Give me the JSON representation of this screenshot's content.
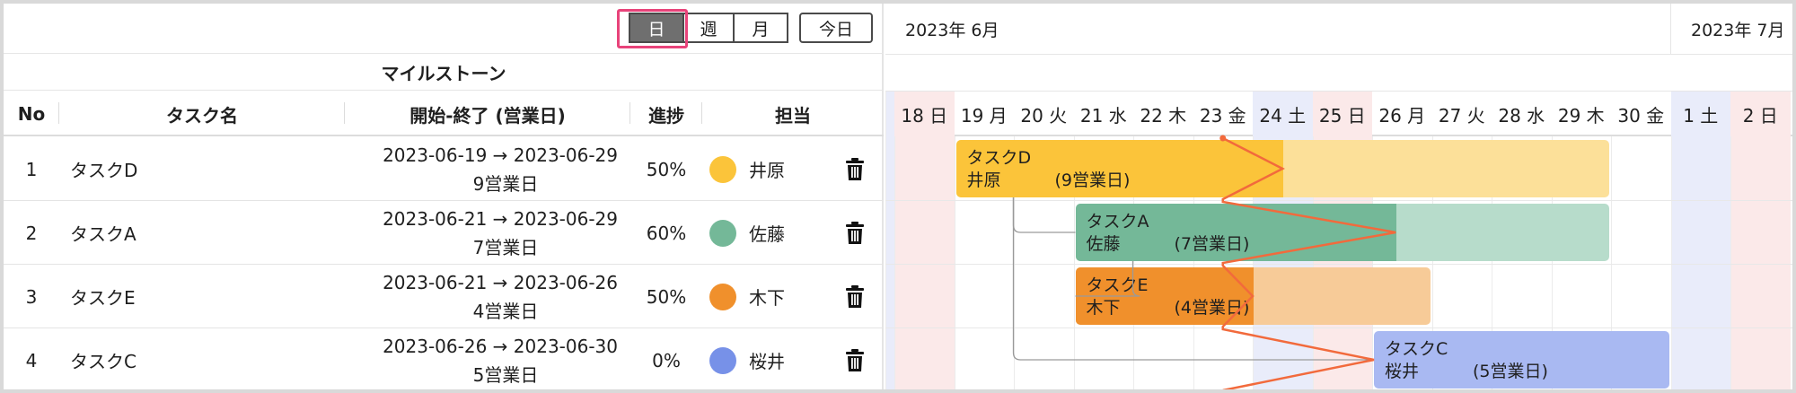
{
  "toolbar": {
    "view_day": "日",
    "view_week": "週",
    "view_month": "月",
    "today": "今日"
  },
  "milestone_label": "マイルストーン",
  "columns": {
    "no": "No",
    "name": "タスク名",
    "period": "開始-終了 (営業日)",
    "progress": "進捗",
    "assignee": "担当"
  },
  "tasks": [
    {
      "no": "1",
      "name": "タスクD",
      "range": "2023-06-19 → 2023-06-29",
      "workdays": "9営業日",
      "progress": "50%",
      "progress_value": 0.5,
      "assignee": "井原",
      "color": "#fbc43a",
      "light": "#fce099"
    },
    {
      "no": "2",
      "name": "タスクA",
      "range": "2023-06-21 → 2023-06-29",
      "workdays": "7営業日",
      "progress": "60%",
      "progress_value": 0.6,
      "assignee": "佐藤",
      "color": "#74b898",
      "light": "#b7dccb"
    },
    {
      "no": "3",
      "name": "タスクE",
      "range": "2023-06-21 → 2023-06-26",
      "workdays": "4営業日",
      "progress": "50%",
      "progress_value": 0.5,
      "assignee": "木下",
      "color": "#f0902c",
      "light": "#f7cb98"
    },
    {
      "no": "4",
      "name": "タスクC",
      "range": "2023-06-26 → 2023-06-30",
      "workdays": "5営業日",
      "progress": "0%",
      "progress_value": 0,
      "assignee": "桜井",
      "color": "#7791e8",
      "light": "#a9b9f2"
    }
  ],
  "gantt": {
    "month_june": "2023年 6月",
    "month_july": "2023年 7月",
    "days": [
      {
        "label": "18 日",
        "kind": "sun"
      },
      {
        "label": "19 月",
        "kind": "wk"
      },
      {
        "label": "20 火",
        "kind": "wk"
      },
      {
        "label": "21 水",
        "kind": "wk"
      },
      {
        "label": "22 木",
        "kind": "wk"
      },
      {
        "label": "23 金",
        "kind": "wk"
      },
      {
        "label": "24 土",
        "kind": "sat"
      },
      {
        "label": "25 日",
        "kind": "sun"
      },
      {
        "label": "26 月",
        "kind": "wk"
      },
      {
        "label": "27 火",
        "kind": "wk"
      },
      {
        "label": "28 水",
        "kind": "wk"
      },
      {
        "label": "29 木",
        "kind": "wk"
      },
      {
        "label": "30 金",
        "kind": "wk"
      },
      {
        "label": "1 土",
        "kind": "sat"
      },
      {
        "label": "2 日",
        "kind": "sun"
      }
    ],
    "bar_workdays": [
      "(9営業日)",
      "(7営業日)",
      "(4営業日)",
      "(5営業日)"
    ],
    "colors": {
      "sat": "#e9ecfa",
      "sun": "#fbe9e9",
      "today_line": "#f26a3c",
      "dependency": "#9a9a9a"
    }
  }
}
